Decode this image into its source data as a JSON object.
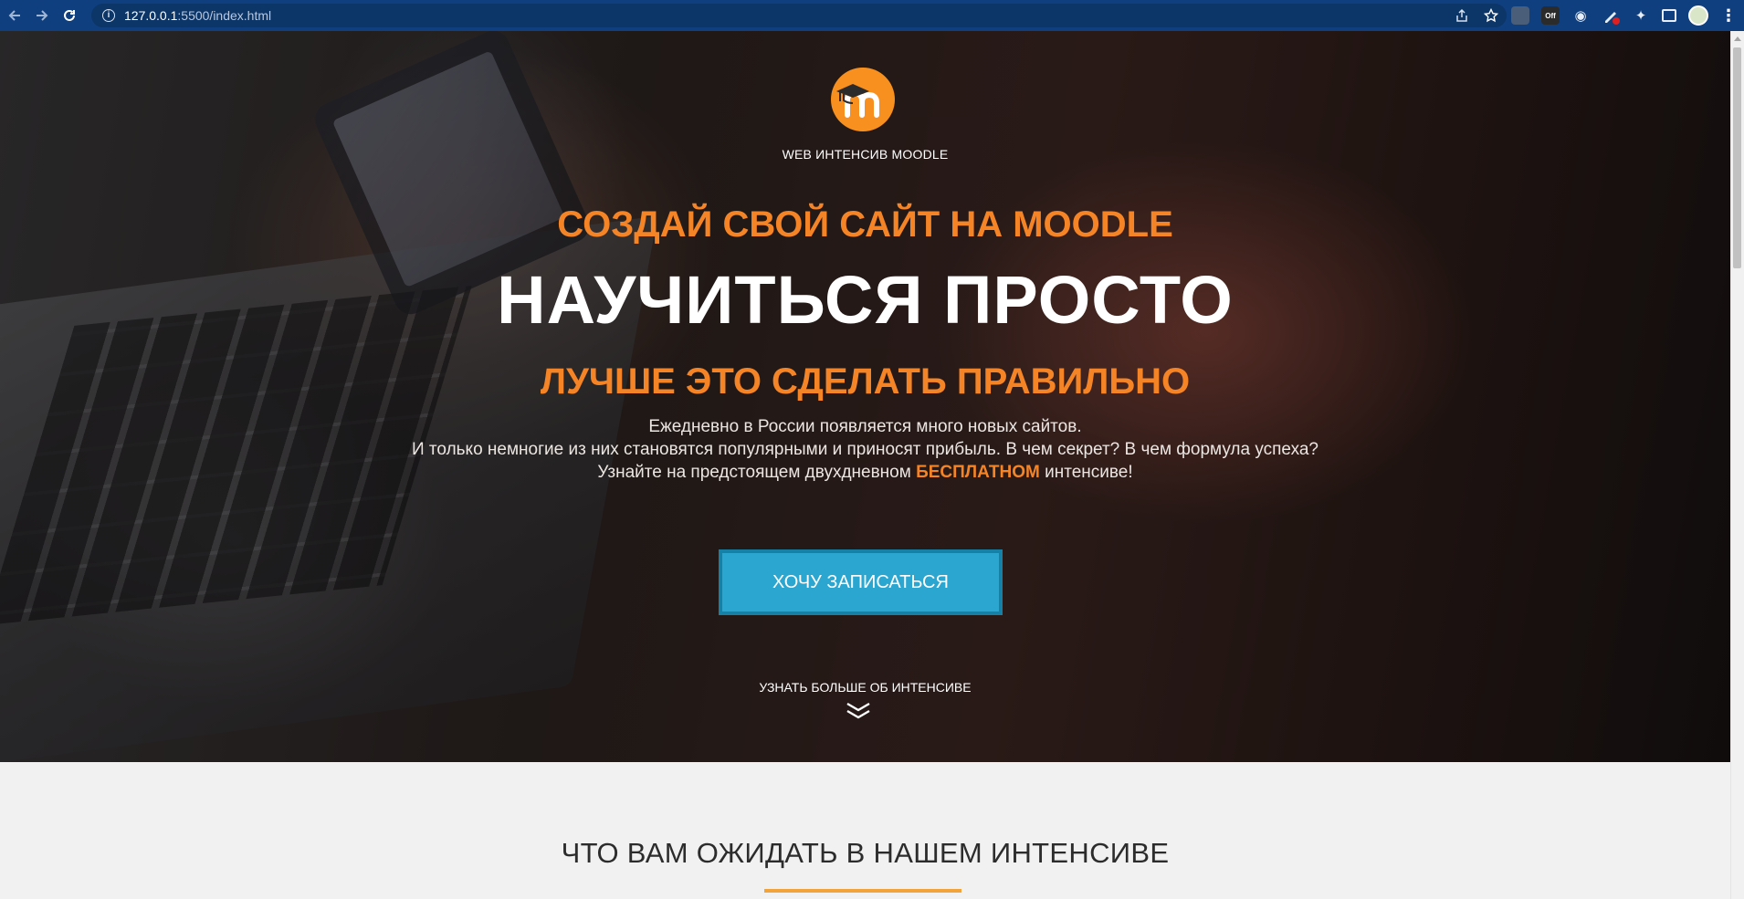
{
  "browser": {
    "url_host": "127.0.0.1",
    "url_rest": ":5500/index.html",
    "ext_off_label": "Off"
  },
  "hero": {
    "brand": "WEB ИНТЕНСИВ MOODLE",
    "subtitle": "СОЗДАЙ СВОЙ САЙТ НА MOODLE",
    "title": "НАУЧИТЬСЯ ПРОСТО",
    "tagline": "ЛУЧШЕ ЭТО СДЕЛАТЬ ПРАВИЛЬНО",
    "desc_line1": "Ежедневно в России появляется много новых сайтов.",
    "desc_line2": "И только немногие из них становятся популярными и приносят прибыль. В чем секрет? В чем формула успеха?",
    "desc_line3_before": "Узнайте на предстоящем двухдневном ",
    "desc_line3_highlight": "БЕСПЛАТНОМ",
    "desc_line3_after": " интенсиве!",
    "cta_label": "ХОЧУ ЗАПИСАТЬСЯ",
    "more_label": "УЗНАТЬ БОЛЬШЕ ОБ ИНТЕНСИВЕ"
  },
  "section": {
    "title": "ЧТО ВАМ ОЖИДАТЬ В НАШЕМ ИНТЕНСИВЕ"
  },
  "colors": {
    "accent_orange": "#f58426",
    "button_blue": "#2aa6d1",
    "chrome_blue": "#0f3f7f"
  }
}
